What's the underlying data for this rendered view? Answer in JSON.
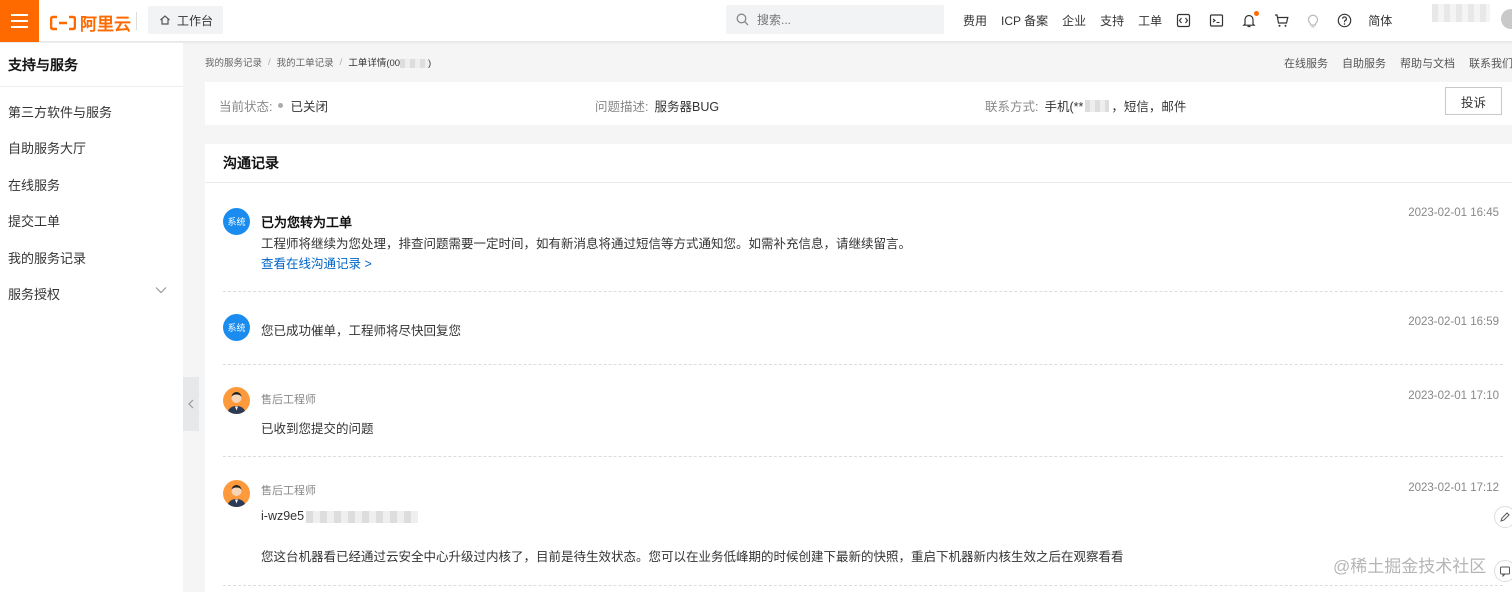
{
  "topbar": {
    "logo_text": "阿里云",
    "workbench_label": "工作台",
    "search_placeholder": "搜索...",
    "nav": [
      "费用",
      "ICP 备案",
      "企业",
      "支持",
      "工单"
    ],
    "icons": [
      "code-icon",
      "terminal-icon",
      "bell-icon",
      "cart-icon",
      "lightbulb-icon",
      "help-icon"
    ],
    "lang_label": "简体",
    "brand_color": "#ff6a00"
  },
  "sidebar": {
    "title": "支持与服务",
    "items": [
      "第三方软件与服务",
      "自助服务大厅",
      "在线服务",
      "提交工单",
      "我的服务记录",
      "服务授权"
    ]
  },
  "breadcrumb": {
    "items": [
      "我的服务记录",
      "我的工单记录"
    ],
    "current": "工单详情(00",
    "current_suffix": ")"
  },
  "help_links": [
    "在线服务",
    "自助服务",
    "帮助与文档",
    "联系我们"
  ],
  "status": {
    "state_label": "当前状态:",
    "state_value": "已关闭",
    "desc_label": "问题描述:",
    "desc_value": "服务器BUG",
    "contact_label": "联系方式:",
    "contact_prefix": "手机(**",
    "contact_suffix": "，短信，邮件",
    "complain_button": "投诉"
  },
  "communication": {
    "title": "沟通记录",
    "records": [
      {
        "avatar_label": "系统",
        "title": "已为您转为工单",
        "text": "工程师将继续为您处理，排查问题需要一定时间，如有新消息将通过短信等方式通知您。如需补充信息，请继续留言。",
        "link": "查看在线沟通记录 >",
        "time": "2023-02-01 16:45"
      },
      {
        "avatar_label": "系统",
        "text": "您已成功催单，工程师将尽快回复您",
        "time": "2023-02-01 16:59"
      },
      {
        "role": "售后工程师",
        "text": "已收到您提交的问题",
        "time": "2023-02-01 17:10"
      },
      {
        "role": "售后工程师",
        "instance_prefix": "i-wz9e5",
        "text": "您这台机器看已经通过云安全中心升级过内核了，目前是待生效状态。您可以在业务低峰期的时候创建下最新的快照，重启下机器新内核生效之后在观察看看",
        "time": "2023-02-01 17:12"
      }
    ]
  },
  "watermark": "@稀土掘金技术社区"
}
